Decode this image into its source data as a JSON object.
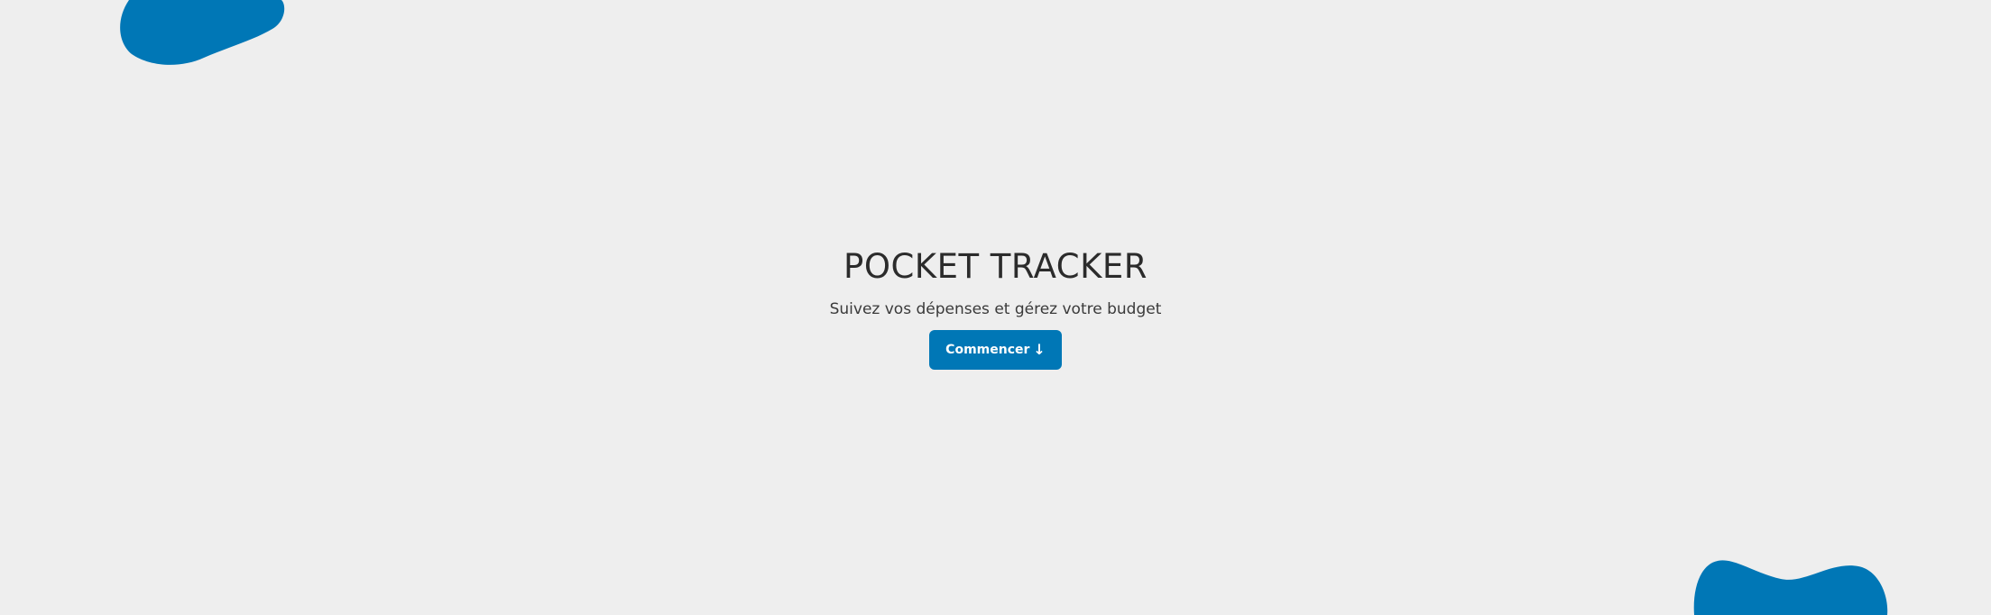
{
  "hero": {
    "title": "POCKET TRACKER",
    "subtitle": "Suivez vos dépenses et gérez votre budget",
    "cta_label": "Commencer",
    "cta_icon": "arrow-down-icon"
  },
  "colors": {
    "background": "#eeeeee",
    "accent": "#0077b6",
    "text": "#2b2b2b"
  }
}
